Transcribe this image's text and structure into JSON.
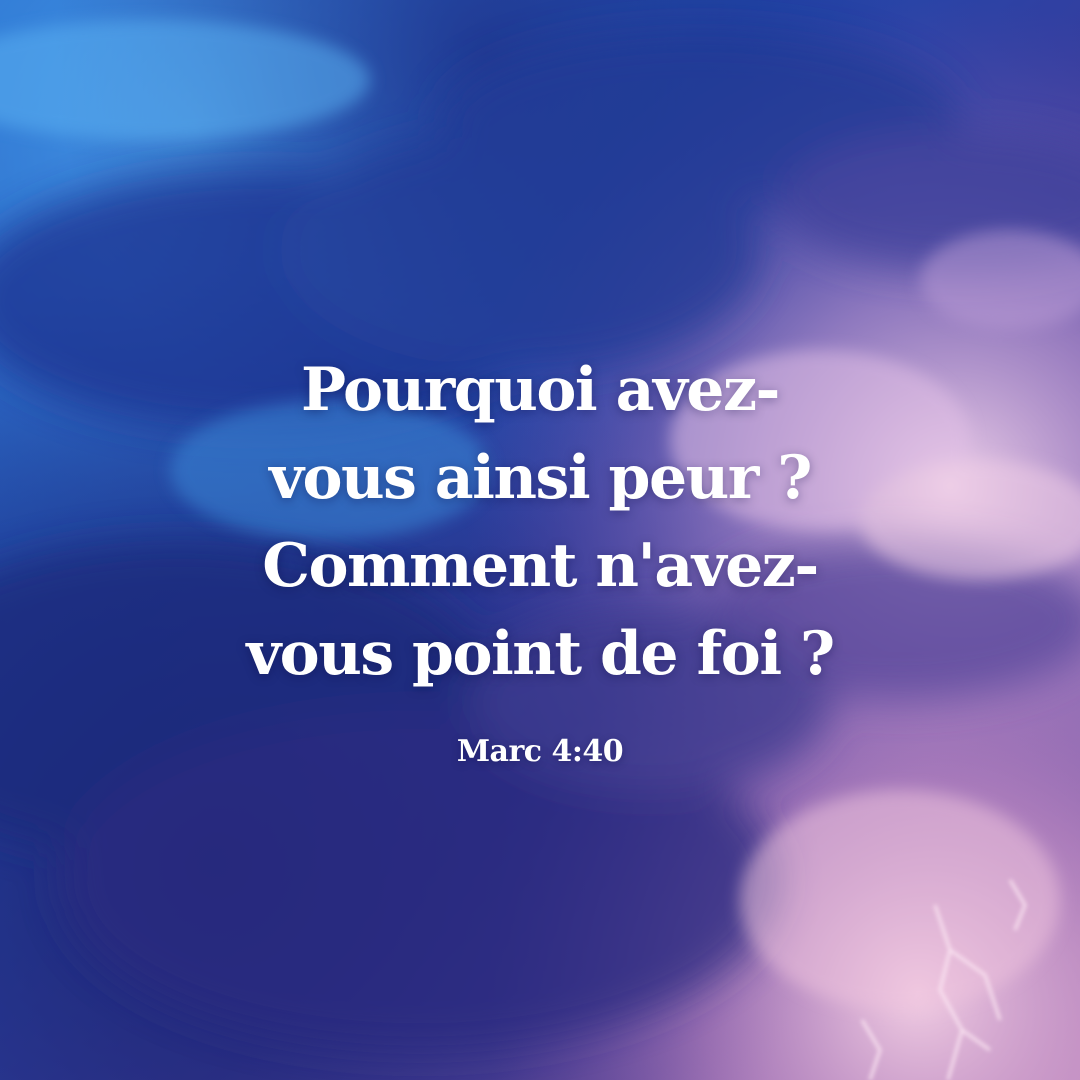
{
  "quote": {
    "lines": [
      "Pourquoi avez-",
      "vous ainsi peur ?",
      "Comment n'avez-",
      "vous point de foi ?"
    ]
  },
  "reference": "Marc 4:40",
  "background": {
    "description_colors": {
      "deep_blue": "#1f3a9a",
      "sky_blue": "#2f78d0",
      "navy": "#1a2060",
      "violet": "#6a4aa8",
      "lavender": "#c7a3d8",
      "pink_glow": "#f1c8e2"
    }
  }
}
